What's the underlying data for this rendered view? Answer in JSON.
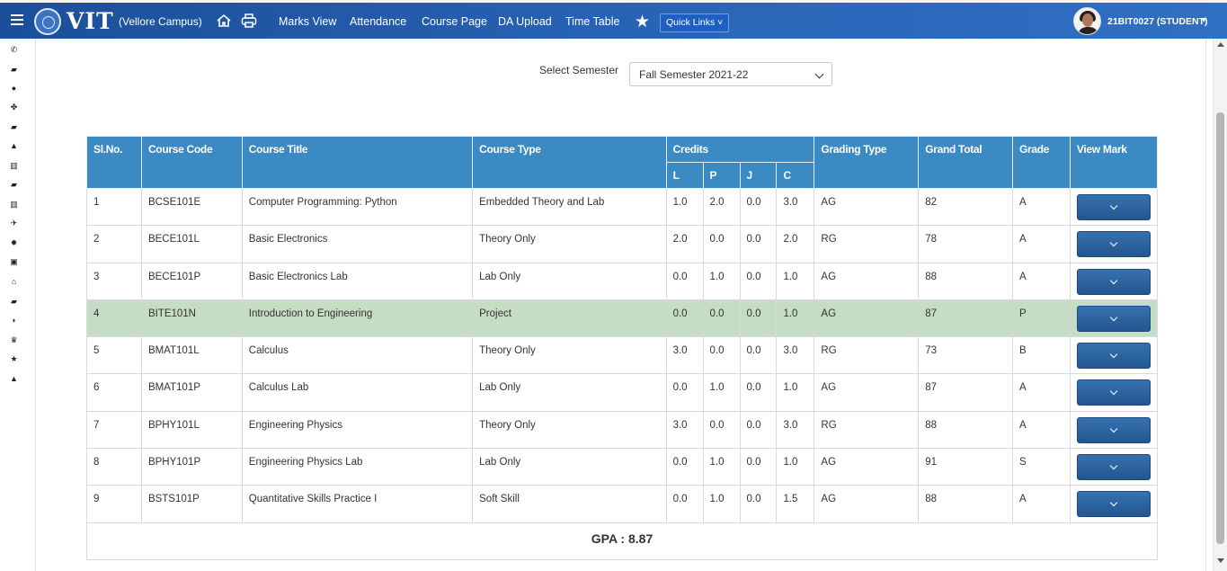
{
  "header": {
    "logo_text": "VIT",
    "campus": "(Vellore Campus)",
    "nav": [
      "Marks View",
      "Attendance",
      "Course Page",
      "DA Upload",
      "Time Table"
    ],
    "quick_links": "Quick Links ˅",
    "user": "21BIT0027 (STUDENT)",
    "user_caret": "▾"
  },
  "semester": {
    "label": "Select Semester",
    "value": "Fall Semester 2021-22"
  },
  "table": {
    "headers": {
      "slno": "Sl.No.",
      "code": "Course Code",
      "title": "Course Title",
      "type": "Course Type",
      "credits": "Credits",
      "l": "L",
      "p": "P",
      "j": "J",
      "c": "C",
      "grading": "Grading Type",
      "total": "Grand Total",
      "grade": "Grade",
      "view": "View Mark"
    },
    "rows": [
      {
        "sl": "1",
        "code": "BCSE101E",
        "title": "Computer Programming: Python",
        "type": "Embedded Theory and Lab",
        "l": "1.0",
        "p": "2.0",
        "j": "0.0",
        "c": "3.0",
        "grading": "AG",
        "total": "82",
        "grade": "A"
      },
      {
        "sl": "2",
        "code": "BECE101L",
        "title": "Basic Electronics",
        "type": "Theory Only",
        "l": "2.0",
        "p": "0.0",
        "j": "0.0",
        "c": "2.0",
        "grading": "RG",
        "total": "78",
        "grade": "A"
      },
      {
        "sl": "3",
        "code": "BECE101P",
        "title": "Basic Electronics Lab",
        "type": "Lab Only",
        "l": "0.0",
        "p": "1.0",
        "j": "0.0",
        "c": "1.0",
        "grading": "AG",
        "total": "88",
        "grade": "A"
      },
      {
        "sl": "4",
        "code": "BITE101N",
        "title": "Introduction to Engineering",
        "type": "Project",
        "l": "0.0",
        "p": "0.0",
        "j": "0.0",
        "c": "1.0",
        "grading": "AG",
        "total": "87",
        "grade": "P"
      },
      {
        "sl": "5",
        "code": "BMAT101L",
        "title": "Calculus",
        "type": "Theory Only",
        "l": "3.0",
        "p": "0.0",
        "j": "0.0",
        "c": "3.0",
        "grading": "RG",
        "total": "73",
        "grade": "B"
      },
      {
        "sl": "6",
        "code": "BMAT101P",
        "title": "Calculus Lab",
        "type": "Lab Only",
        "l": "0.0",
        "p": "1.0",
        "j": "0.0",
        "c": "1.0",
        "grading": "AG",
        "total": "87",
        "grade": "A"
      },
      {
        "sl": "7",
        "code": "BPHY101L",
        "title": "Engineering Physics",
        "type": "Theory Only",
        "l": "3.0",
        "p": "0.0",
        "j": "0.0",
        "c": "3.0",
        "grading": "RG",
        "total": "88",
        "grade": "A"
      },
      {
        "sl": "8",
        "code": "BPHY101P",
        "title": "Engineering Physics Lab",
        "type": "Lab Only",
        "l": "0.0",
        "p": "1.0",
        "j": "0.0",
        "c": "1.0",
        "grading": "AG",
        "total": "91",
        "grade": "S"
      },
      {
        "sl": "9",
        "code": "BSTS101P",
        "title": "Quantitative Skills Practice I",
        "type": "Soft Skill",
        "l": "0.0",
        "p": "1.0",
        "j": "0.0",
        "c": "1.5",
        "grading": "AG",
        "total": "88",
        "grade": "A"
      }
    ],
    "highlight_row": 4,
    "highlight_color": "#c5dcc5",
    "gpa": "GPA : 8.87"
  },
  "sidebar_icons": [
    "phone-icon",
    "briefcase-icon",
    "info-icon",
    "paw-icon",
    "book-icon",
    "graduation-cap-icon",
    "institution-icon",
    "book-icon",
    "institution-icon",
    "plane-icon",
    "gear-icon",
    "money-icon",
    "home-icon",
    "book-icon",
    "shield-icon",
    "trophy-icon",
    "star-icon",
    "lock-icon"
  ],
  "sidebar_glyphs": [
    "✆",
    "▰",
    "●",
    "✤",
    "▰",
    "▲",
    "▥",
    "▰",
    "▥",
    "✈",
    "✹",
    "▣",
    "⌂",
    "▰",
    "◗",
    "♛",
    "★",
    "▲"
  ],
  "colors": {
    "header": "#2b66b8",
    "table_header": "#3b8ac4",
    "button": "#2a5f98"
  }
}
